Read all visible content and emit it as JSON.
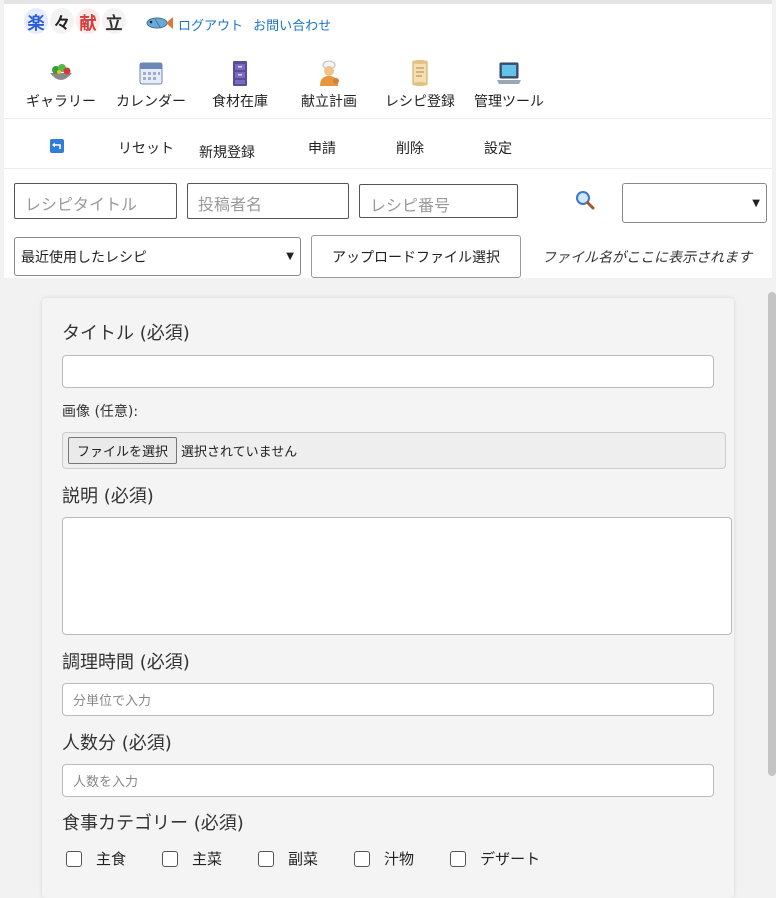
{
  "logo": [
    "楽",
    "々",
    "献",
    "立"
  ],
  "header_links": {
    "logout": "ログアウト",
    "contact": "お問い合わせ"
  },
  "nav": [
    {
      "label": "ギャラリー",
      "icon": "salad-icon"
    },
    {
      "label": "カレンダー",
      "icon": "calendar-icon"
    },
    {
      "label": "食材在庫",
      "icon": "storage-cabinet-icon"
    },
    {
      "label": "献立計画",
      "icon": "cook-icon"
    },
    {
      "label": "レシピ登録",
      "icon": "scroll-icon"
    },
    {
      "label": "管理ツール",
      "icon": "laptop-icon"
    }
  ],
  "actions": {
    "reset": "リセット",
    "new_register": "新規登録",
    "apply": "申請",
    "delete": "削除",
    "settings": "設定"
  },
  "search": {
    "recipe_title_placeholder": "レシピタイトル",
    "author_placeholder": "投稿者名",
    "recipe_number_placeholder": "レシピ番号",
    "right_select_value": ""
  },
  "recent": {
    "selected": "最近使用したレシピ"
  },
  "upload": {
    "button_label": "アップロードファイル選択",
    "filename_placeholder": "ファイル名がここに表示されます"
  },
  "form": {
    "title_label": "タイトル (必須)",
    "image_label": "画像 (任意):",
    "file_button": "ファイルを選択",
    "file_status": "選択されていません",
    "description_label": "説明 (必須)",
    "cook_time_label": "調理時間 (必須)",
    "cook_time_placeholder": "分単位で入力",
    "servings_label": "人数分 (必須)",
    "servings_placeholder": "人数を入力",
    "category_label": "食事カテゴリー (必須)",
    "categories": [
      "主食",
      "主菜",
      "副菜",
      "汁物",
      "デザート"
    ]
  }
}
